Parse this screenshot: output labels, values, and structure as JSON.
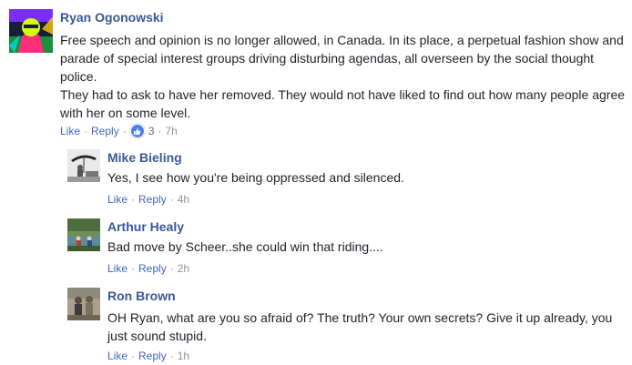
{
  "comments": [
    {
      "author": "Ryan Ogonowski",
      "text_lines": [
        "Free speech and opinion is no longer allowed, in Canada. In its place, a perpetual fashion show and",
        "parade of special interest groups driving disturbing agendas, all overseen by the social thought",
        "police.",
        "They had to ask to have her removed. They would not have liked to find out how many people agree",
        "with her on some level."
      ],
      "like_label": "Like",
      "reply_label": "Reply",
      "reaction_count": "3",
      "time": "7h",
      "reaction_icon": "like-icon",
      "avatar_colors": [
        "#d4ff00",
        "#1a8f3c",
        "#7b2cff",
        "#ff2e7a",
        "#1b1b3a"
      ]
    },
    {
      "author": "Mike Bieling",
      "text_lines": [
        "Yes, I see how you're being oppressed and silenced."
      ],
      "like_label": "Like",
      "reply_label": "Reply",
      "time": "4h"
    },
    {
      "author": "Arthur Healy",
      "text_lines": [
        "Bad move by Scheer..she could win that riding...."
      ],
      "like_label": "Like",
      "reply_label": "Reply",
      "time": "2h"
    },
    {
      "author": "Ron Brown",
      "text_lines": [
        "OH Ryan, what are you so afraid of? The truth? Your own secrets? Give it up already, you",
        "just sound stupid."
      ],
      "like_label": "Like",
      "reply_label": "Reply",
      "time": "1h"
    }
  ],
  "colors": {
    "author_link": "#385898",
    "action_link": "#4267b2",
    "meta_gray": "#90949c",
    "body_text": "#1d2129",
    "like_blue": "#4a80ec"
  }
}
